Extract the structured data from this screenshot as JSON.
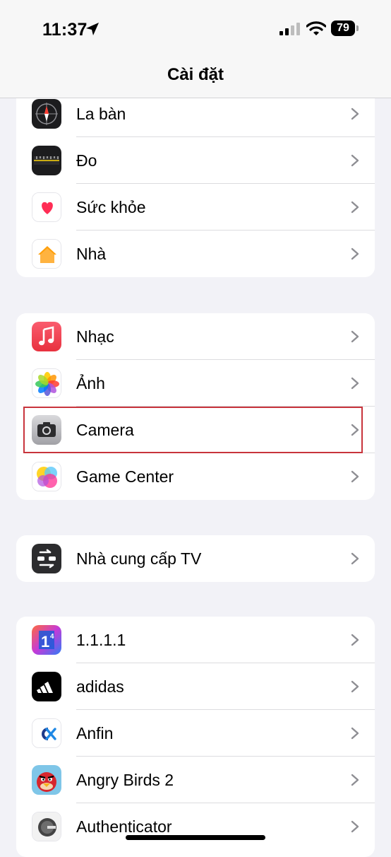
{
  "status_bar": {
    "time": "11:37",
    "battery_percent": "79"
  },
  "nav": {
    "title": "Cài đặt"
  },
  "groups": [
    {
      "items": [
        {
          "label": "La bàn",
          "icon": "compass-icon"
        },
        {
          "label": "Đo",
          "icon": "measure-icon"
        },
        {
          "label": "Sức khỏe",
          "icon": "health-icon"
        },
        {
          "label": "Nhà",
          "icon": "home-icon"
        }
      ]
    },
    {
      "items": [
        {
          "label": "Nhạc",
          "icon": "music-icon"
        },
        {
          "label": "Ảnh",
          "icon": "photos-icon"
        },
        {
          "label": "Camera",
          "icon": "camera-icon",
          "highlighted": true
        },
        {
          "label": "Game Center",
          "icon": "game-center-icon"
        }
      ]
    },
    {
      "items": [
        {
          "label": "Nhà cung cấp TV",
          "icon": "tv-provider-icon"
        }
      ]
    },
    {
      "items": [
        {
          "label": "1.1.1.1",
          "icon": "1111-app-icon"
        },
        {
          "label": "adidas",
          "icon": "adidas-icon"
        },
        {
          "label": "Anfin",
          "icon": "anfin-icon"
        },
        {
          "label": "Angry Birds 2",
          "icon": "angry-birds-icon"
        },
        {
          "label": "Authenticator",
          "icon": "authenticator-icon"
        }
      ]
    }
  ],
  "colors": {
    "highlight_border": "#c8343c",
    "background": "#f2f2f7"
  }
}
